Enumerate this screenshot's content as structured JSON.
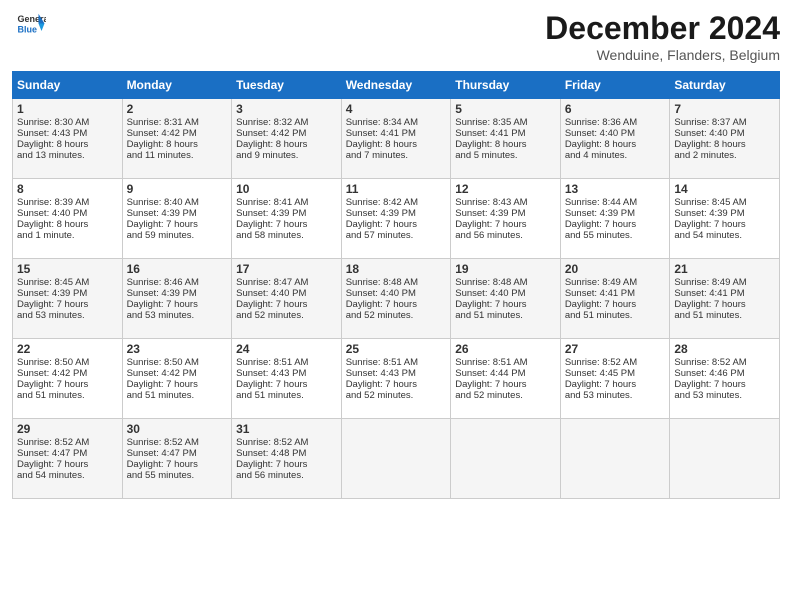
{
  "header": {
    "logo_line1": "General",
    "logo_line2": "Blue",
    "month": "December 2024",
    "location": "Wenduine, Flanders, Belgium"
  },
  "days_of_week": [
    "Sunday",
    "Monday",
    "Tuesday",
    "Wednesday",
    "Thursday",
    "Friday",
    "Saturday"
  ],
  "weeks": [
    [
      {
        "day": "1",
        "rise": "8:30 AM",
        "set": "4:43 PM",
        "dh": "8 hours",
        "dm": "13 minutes"
      },
      {
        "day": "2",
        "rise": "8:31 AM",
        "set": "4:42 PM",
        "dh": "8 hours",
        "dm": "11 minutes"
      },
      {
        "day": "3",
        "rise": "8:32 AM",
        "set": "4:42 PM",
        "dh": "8 hours",
        "dm": "9 minutes"
      },
      {
        "day": "4",
        "rise": "8:34 AM",
        "set": "4:41 PM",
        "dh": "8 hours",
        "dm": "7 minutes"
      },
      {
        "day": "5",
        "rise": "8:35 AM",
        "set": "4:41 PM",
        "dh": "8 hours",
        "dm": "5 minutes"
      },
      {
        "day": "6",
        "rise": "8:36 AM",
        "set": "4:40 PM",
        "dh": "8 hours",
        "dm": "4 minutes"
      },
      {
        "day": "7",
        "rise": "8:37 AM",
        "set": "4:40 PM",
        "dh": "8 hours",
        "dm": "2 minutes"
      }
    ],
    [
      {
        "day": "8",
        "rise": "8:39 AM",
        "set": "4:40 PM",
        "dh": "8 hours",
        "dm": "1 minute"
      },
      {
        "day": "9",
        "rise": "8:40 AM",
        "set": "4:39 PM",
        "dh": "7 hours",
        "dm": "59 minutes"
      },
      {
        "day": "10",
        "rise": "8:41 AM",
        "set": "4:39 PM",
        "dh": "7 hours",
        "dm": "58 minutes"
      },
      {
        "day": "11",
        "rise": "8:42 AM",
        "set": "4:39 PM",
        "dh": "7 hours",
        "dm": "57 minutes"
      },
      {
        "day": "12",
        "rise": "8:43 AM",
        "set": "4:39 PM",
        "dh": "7 hours",
        "dm": "56 minutes"
      },
      {
        "day": "13",
        "rise": "8:44 AM",
        "set": "4:39 PM",
        "dh": "7 hours",
        "dm": "55 minutes"
      },
      {
        "day": "14",
        "rise": "8:45 AM",
        "set": "4:39 PM",
        "dh": "7 hours",
        "dm": "54 minutes"
      }
    ],
    [
      {
        "day": "15",
        "rise": "8:45 AM",
        "set": "4:39 PM",
        "dh": "7 hours",
        "dm": "53 minutes"
      },
      {
        "day": "16",
        "rise": "8:46 AM",
        "set": "4:39 PM",
        "dh": "7 hours",
        "dm": "53 minutes"
      },
      {
        "day": "17",
        "rise": "8:47 AM",
        "set": "4:40 PM",
        "dh": "7 hours",
        "dm": "52 minutes"
      },
      {
        "day": "18",
        "rise": "8:48 AM",
        "set": "4:40 PM",
        "dh": "7 hours",
        "dm": "52 minutes"
      },
      {
        "day": "19",
        "rise": "8:48 AM",
        "set": "4:40 PM",
        "dh": "7 hours",
        "dm": "51 minutes"
      },
      {
        "day": "20",
        "rise": "8:49 AM",
        "set": "4:41 PM",
        "dh": "7 hours",
        "dm": "51 minutes"
      },
      {
        "day": "21",
        "rise": "8:49 AM",
        "set": "4:41 PM",
        "dh": "7 hours",
        "dm": "51 minutes"
      }
    ],
    [
      {
        "day": "22",
        "rise": "8:50 AM",
        "set": "4:42 PM",
        "dh": "7 hours",
        "dm": "51 minutes"
      },
      {
        "day": "23",
        "rise": "8:50 AM",
        "set": "4:42 PM",
        "dh": "7 hours",
        "dm": "51 minutes"
      },
      {
        "day": "24",
        "rise": "8:51 AM",
        "set": "4:43 PM",
        "dh": "7 hours",
        "dm": "51 minutes"
      },
      {
        "day": "25",
        "rise": "8:51 AM",
        "set": "4:43 PM",
        "dh": "7 hours",
        "dm": "52 minutes"
      },
      {
        "day": "26",
        "rise": "8:51 AM",
        "set": "4:44 PM",
        "dh": "7 hours",
        "dm": "52 minutes"
      },
      {
        "day": "27",
        "rise": "8:52 AM",
        "set": "4:45 PM",
        "dh": "7 hours",
        "dm": "53 minutes"
      },
      {
        "day": "28",
        "rise": "8:52 AM",
        "set": "4:46 PM",
        "dh": "7 hours",
        "dm": "53 minutes"
      }
    ],
    [
      {
        "day": "29",
        "rise": "8:52 AM",
        "set": "4:47 PM",
        "dh": "7 hours",
        "dm": "54 minutes"
      },
      {
        "day": "30",
        "rise": "8:52 AM",
        "set": "4:47 PM",
        "dh": "7 hours",
        "dm": "55 minutes"
      },
      {
        "day": "31",
        "rise": "8:52 AM",
        "set": "4:48 PM",
        "dh": "7 hours",
        "dm": "56 minutes"
      },
      null,
      null,
      null,
      null
    ]
  ]
}
